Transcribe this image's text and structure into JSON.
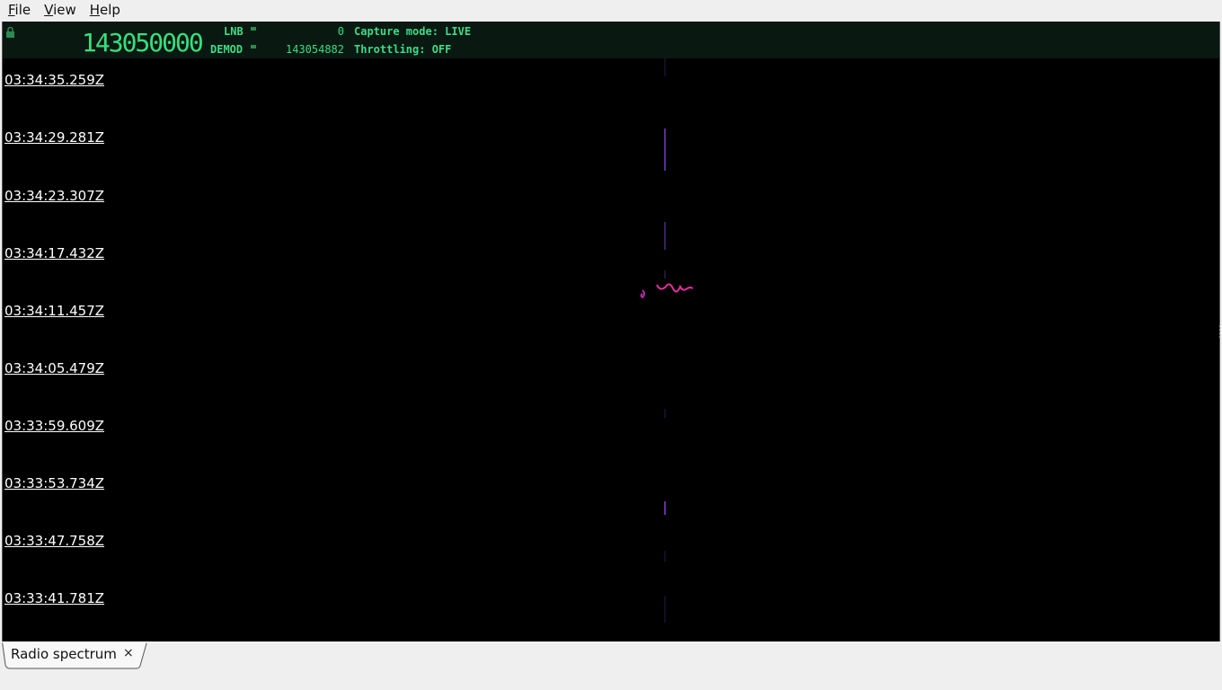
{
  "menu": {
    "file": {
      "mnemonic": "F",
      "rest": "ile"
    },
    "view": {
      "mnemonic": "V",
      "rest": "iew"
    },
    "help": {
      "mnemonic": "H",
      "rest": "elp"
    }
  },
  "header": {
    "main_frequency": "143050000",
    "lnb_label": "LNB",
    "lnb_value": "0",
    "demod_label": "DEMOD",
    "demod_value": "143054882",
    "capture_mode": "Capture mode: LIVE",
    "throttling": "Throttling: OFF"
  },
  "waterfall": {
    "timestamps": [
      "03:34:35.259Z",
      "03:34:29.281Z",
      "03:34:23.307Z",
      "03:34:17.432Z",
      "03:34:11.457Z",
      "03:34:05.479Z",
      "03:33:59.609Z",
      "03:33:53.734Z",
      "03:33:47.758Z",
      "03:33:41.781Z"
    ]
  },
  "tabs": [
    {
      "label": "Radio spectrum",
      "close": "×"
    }
  ],
  "colors": {
    "header_bg": "#0a1812",
    "accent_green": "#3ddc84",
    "signal_magenta": "#e0309a",
    "signal_purple": "#6a2aa8"
  }
}
